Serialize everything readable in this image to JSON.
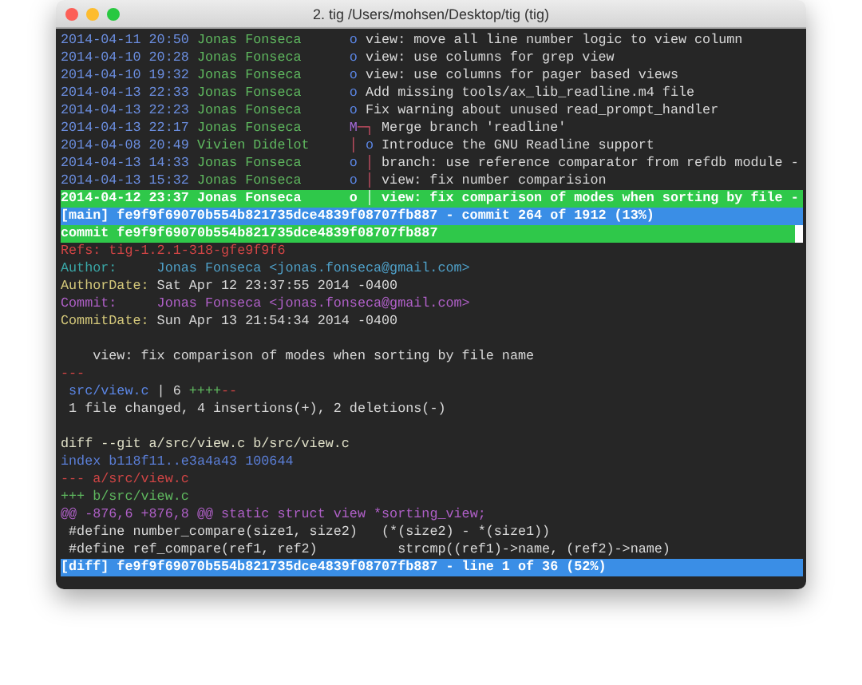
{
  "window": {
    "title": "2. tig  /Users/mohsen/Desktop/tig (tig)"
  },
  "log": [
    {
      "date": "2014-04-11 20:50",
      "author": "Jonas Fonseca",
      "graph": [
        {
          "text": "o",
          "kind": "commit"
        }
      ],
      "message": "view: move all line number logic to view column",
      "selected": false
    },
    {
      "date": "2014-04-10 20:28",
      "author": "Jonas Fonseca",
      "graph": [
        {
          "text": "o",
          "kind": "commit"
        }
      ],
      "message": "view: use columns for grep view",
      "selected": false
    },
    {
      "date": "2014-04-10 19:32",
      "author": "Jonas Fonseca",
      "graph": [
        {
          "text": "o",
          "kind": "commit"
        }
      ],
      "message": "view: use columns for pager based views",
      "selected": false
    },
    {
      "date": "2014-04-13 22:33",
      "author": "Jonas Fonseca",
      "graph": [
        {
          "text": "o",
          "kind": "commit"
        }
      ],
      "message": "Add missing tools/ax_lib_readline.m4 file",
      "selected": false
    },
    {
      "date": "2014-04-13 22:23",
      "author": "Jonas Fonseca",
      "graph": [
        {
          "text": "o",
          "kind": "commit"
        }
      ],
      "message": "Fix warning about unused read_prompt_handler",
      "selected": false
    },
    {
      "date": "2014-04-13 22:17",
      "author": "Jonas Fonseca",
      "graph": [
        {
          "text": "M",
          "kind": "merge"
        },
        {
          "text": "─┐",
          "kind": "branch"
        }
      ],
      "message": "Merge branch 'readline'",
      "selected": false
    },
    {
      "date": "2014-04-08 20:49",
      "author": "Vivien Didelot",
      "graph": [
        {
          "text": "│",
          "kind": "branch"
        },
        {
          "text": " o",
          "kind": "commit"
        }
      ],
      "message": "Introduce the GNU Readline support",
      "selected": false
    },
    {
      "date": "2014-04-13 14:33",
      "author": "Jonas Fonseca",
      "graph": [
        {
          "text": "o",
          "kind": "commit"
        },
        {
          "text": " │",
          "kind": "branch"
        }
      ],
      "message": "branch: use reference comparator from refdb module -",
      "selected": false
    },
    {
      "date": "2014-04-13 15:32",
      "author": "Jonas Fonseca",
      "graph": [
        {
          "text": "o",
          "kind": "commit"
        },
        {
          "text": " │",
          "kind": "branch"
        }
      ],
      "message": "view: fix number comparision",
      "selected": false
    },
    {
      "date": "2014-04-12 23:37",
      "author": "Jonas Fonseca",
      "graph": [
        {
          "text": "o",
          "kind": "commit"
        },
        {
          "text": " │",
          "kind": "branch"
        }
      ],
      "message": "view: fix comparison of modes when sorting by file -",
      "selected": true
    }
  ],
  "main_status": {
    "view": "[main]",
    "text": "fe9f9f69070b554b821735dce4839f08707fb887 - commit 264 of 1912 (13%)"
  },
  "detail": [
    {
      "kind": "commit",
      "text": "commit fe9f9f69070b554b821735dce4839f08707fb887",
      "selected": true,
      "cursor": true
    },
    {
      "kind": "refs",
      "text": "Refs: tig-1.2.1-318-gfe9f9f6"
    },
    {
      "kind": "author",
      "label": "Author:",
      "value": "Jonas Fonseca <jonas.fonseca@gmail.com>"
    },
    {
      "kind": "date",
      "label": "AuthorDate:",
      "value": "Sat Apr 12 23:37:55 2014 -0400"
    },
    {
      "kind": "committer",
      "label": "Commit:",
      "value": "Jonas Fonseca <jonas.fonseca@gmail.com>"
    },
    {
      "kind": "date",
      "label": "CommitDate:",
      "value": "Sun Apr 13 21:54:34 2014 -0400"
    },
    {
      "kind": "blank"
    },
    {
      "kind": "context",
      "text": "    view: fix comparison of modes when sorting by file name"
    },
    {
      "kind": "removed",
      "text": "---"
    },
    {
      "kind": "stat",
      "file": "src/view.c",
      "count": "| 6",
      "plus": "++++",
      "minus": "--"
    },
    {
      "kind": "context",
      "text": " 1 file changed, 4 insertions(+), 2 deletions(-)"
    },
    {
      "kind": "blank"
    },
    {
      "kind": "diff",
      "text": "diff --git a/src/view.c b/src/view.c"
    },
    {
      "kind": "index",
      "text": "index b118f11..e3a4a43 100644"
    },
    {
      "kind": "removed",
      "text": "--- a/src/view.c"
    },
    {
      "kind": "added",
      "text": "+++ b/src/view.c"
    },
    {
      "kind": "hunk",
      "text": "@@ -876,6 +876,8 @@ static struct view *sorting_view;"
    },
    {
      "kind": "context",
      "text": " #define number_compare(size1, size2)   (*(size2) - *(size1))"
    },
    {
      "kind": "context",
      "text": " #define ref_compare(ref1, ref2)          strcmp((ref1)->name, (ref2)->name)"
    }
  ],
  "diff_status": {
    "view": "[diff]",
    "text": "fe9f9f69070b554b821735dce4839f08707fb887 - line 1 of 36 (52%)"
  }
}
